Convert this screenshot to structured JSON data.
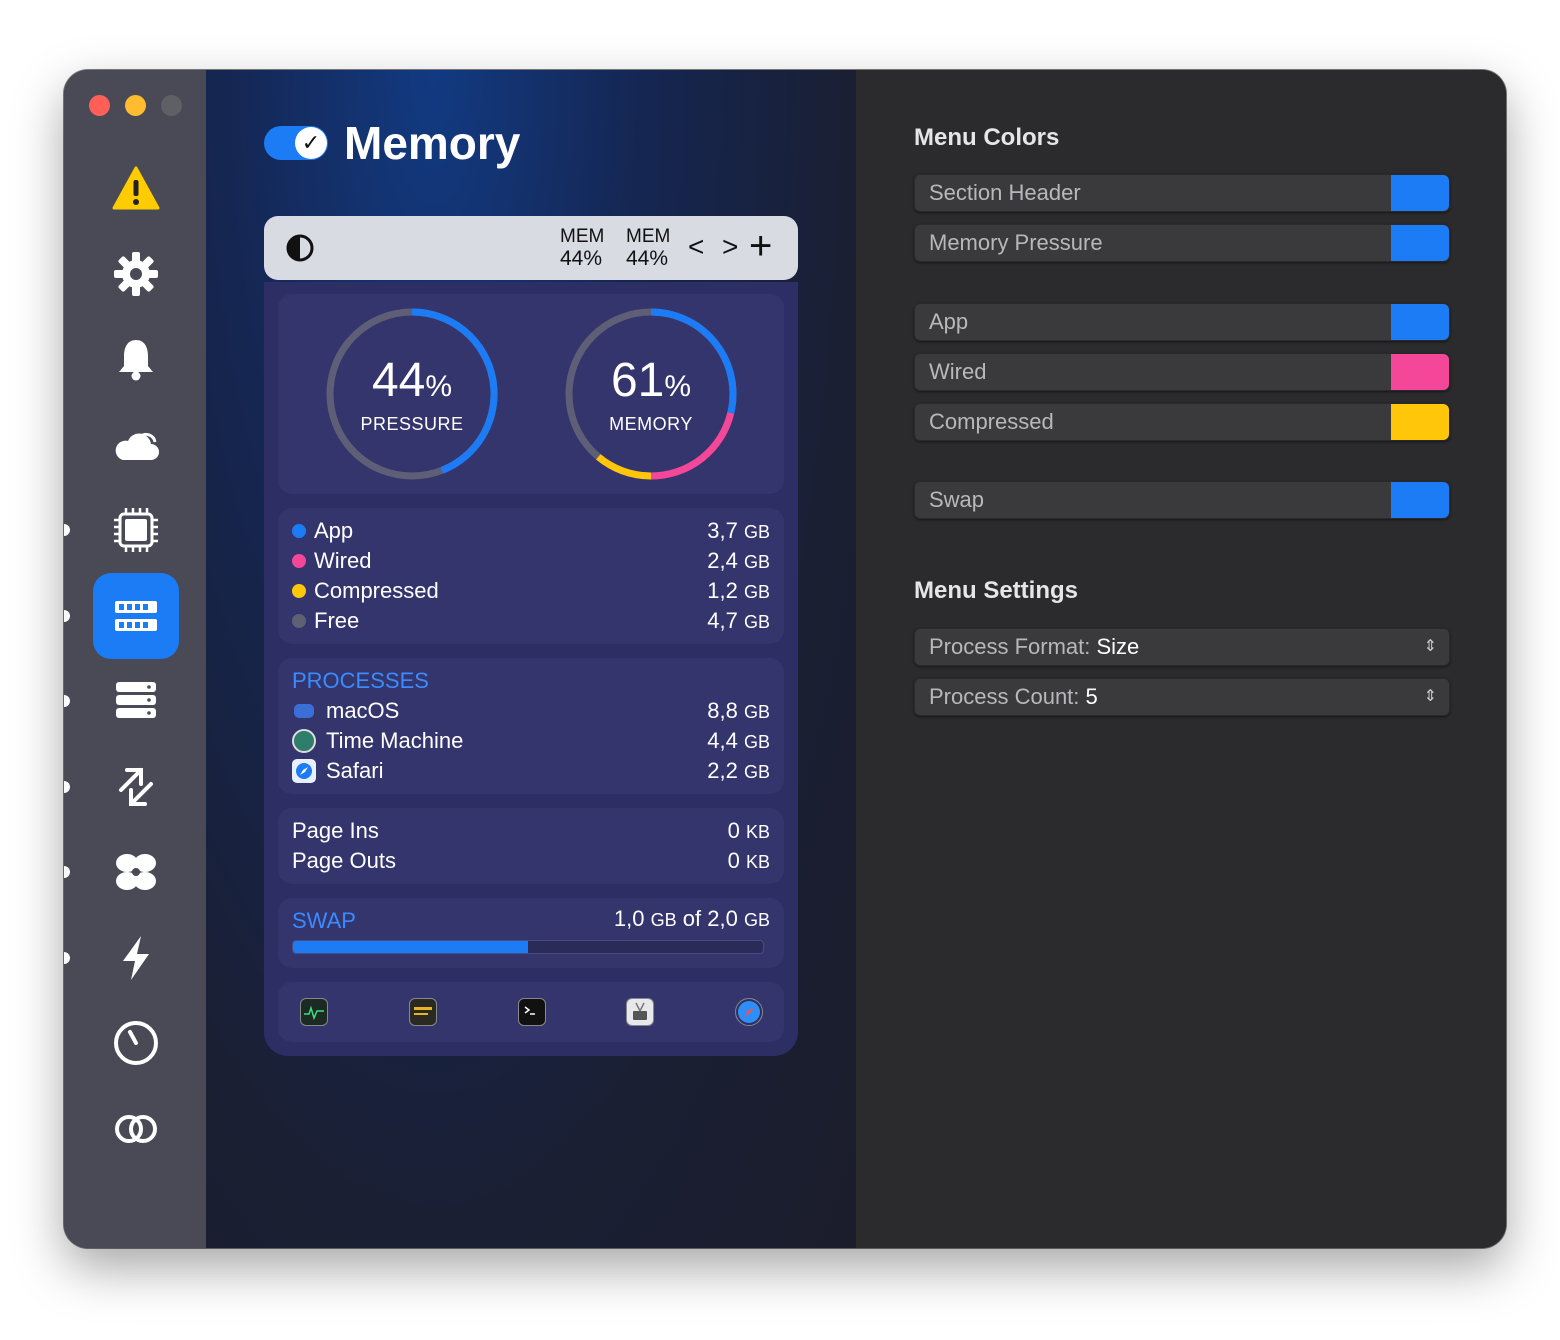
{
  "window": {
    "traffic_lights": [
      {
        "name": "close",
        "color": "#ff5f57"
      },
      {
        "name": "minimize",
        "color": "#febc2e"
      },
      {
        "name": "zoom",
        "color": "#5f5f66"
      }
    ]
  },
  "sidebar": {
    "items": [
      {
        "id": "warning",
        "icon": "warning-icon",
        "active": false
      },
      {
        "id": "settings",
        "icon": "gear-icon",
        "active": false
      },
      {
        "id": "notifications",
        "icon": "bell-icon",
        "active": false
      },
      {
        "id": "weather",
        "icon": "cloud-icon",
        "active": false
      },
      {
        "id": "cpu",
        "icon": "cpu-icon",
        "active": false
      },
      {
        "id": "memory",
        "icon": "memory-icon",
        "active": true
      },
      {
        "id": "disk",
        "icon": "disk-icon",
        "active": false
      },
      {
        "id": "network",
        "icon": "network-icon",
        "active": false
      },
      {
        "id": "fan",
        "icon": "fan-icon",
        "active": false
      },
      {
        "id": "battery",
        "icon": "lightning-icon",
        "active": false
      },
      {
        "id": "clock",
        "icon": "clock-icon",
        "active": false
      },
      {
        "id": "combine",
        "icon": "rings-icon",
        "active": false
      }
    ],
    "accent": "#1c7cf6"
  },
  "preview": {
    "title": "Memory",
    "enabled": true,
    "menubar": {
      "stats": [
        {
          "label": "MEM",
          "value": "44%"
        },
        {
          "label": "MEM",
          "value": "44%"
        }
      ],
      "prev_glyph": "<",
      "next_glyph": ">",
      "add_glyph": "+"
    },
    "gauges": [
      {
        "value": "44",
        "unit": "%",
        "caption": "PRESSURE"
      },
      {
        "value": "61",
        "unit": "%",
        "caption": "MEMORY"
      }
    ],
    "breakdown": [
      {
        "label": "App",
        "value": "3,7",
        "unit": "GB",
        "color": "#1c7cf6"
      },
      {
        "label": "Wired",
        "value": "2,4",
        "unit": "GB",
        "color": "#f5479a"
      },
      {
        "label": "Compressed",
        "value": "1,2",
        "unit": "GB",
        "color": "#ffc60a"
      },
      {
        "label": "Free",
        "value": "4,7",
        "unit": "GB",
        "color": "#5f6072"
      }
    ],
    "processes": {
      "title": "PROCESSES",
      "items": [
        {
          "name": "macOS",
          "value": "8,8",
          "unit": "GB"
        },
        {
          "name": "Time Machine",
          "value": "4,4",
          "unit": "GB"
        },
        {
          "name": "Safari",
          "value": "2,2",
          "unit": "GB"
        }
      ]
    },
    "paging": [
      {
        "label": "Page Ins",
        "value": "0",
        "unit": "KB"
      },
      {
        "label": "Page Outs",
        "value": "0",
        "unit": "KB"
      }
    ],
    "swap": {
      "title": "SWAP",
      "used": "1,0",
      "used_unit": "GB",
      "of_text": "of",
      "total": "2,0",
      "total_unit": "GB",
      "fraction": 0.5
    },
    "dock": [
      "activity-monitor-icon",
      "console-icon",
      "terminal-icon",
      "system-info-icon",
      "safari-icon"
    ]
  },
  "settings": {
    "menu_colors_title": "Menu Colors",
    "color_rows": [
      {
        "label": "Section Header",
        "color": "#1c7cf6"
      },
      {
        "label": "Memory Pressure",
        "color": "#1c7cf6"
      },
      {
        "label": "App",
        "color": "#1c7cf6"
      },
      {
        "label": "Wired",
        "color": "#f5479a"
      },
      {
        "label": "Compressed",
        "color": "#ffc60a"
      },
      {
        "label": "Swap",
        "color": "#1c7cf6"
      }
    ],
    "menu_settings_title": "Menu Settings",
    "selects": [
      {
        "label": "Process Format:",
        "value": "Size"
      },
      {
        "label": "Process Count:",
        "value": "5"
      }
    ]
  }
}
